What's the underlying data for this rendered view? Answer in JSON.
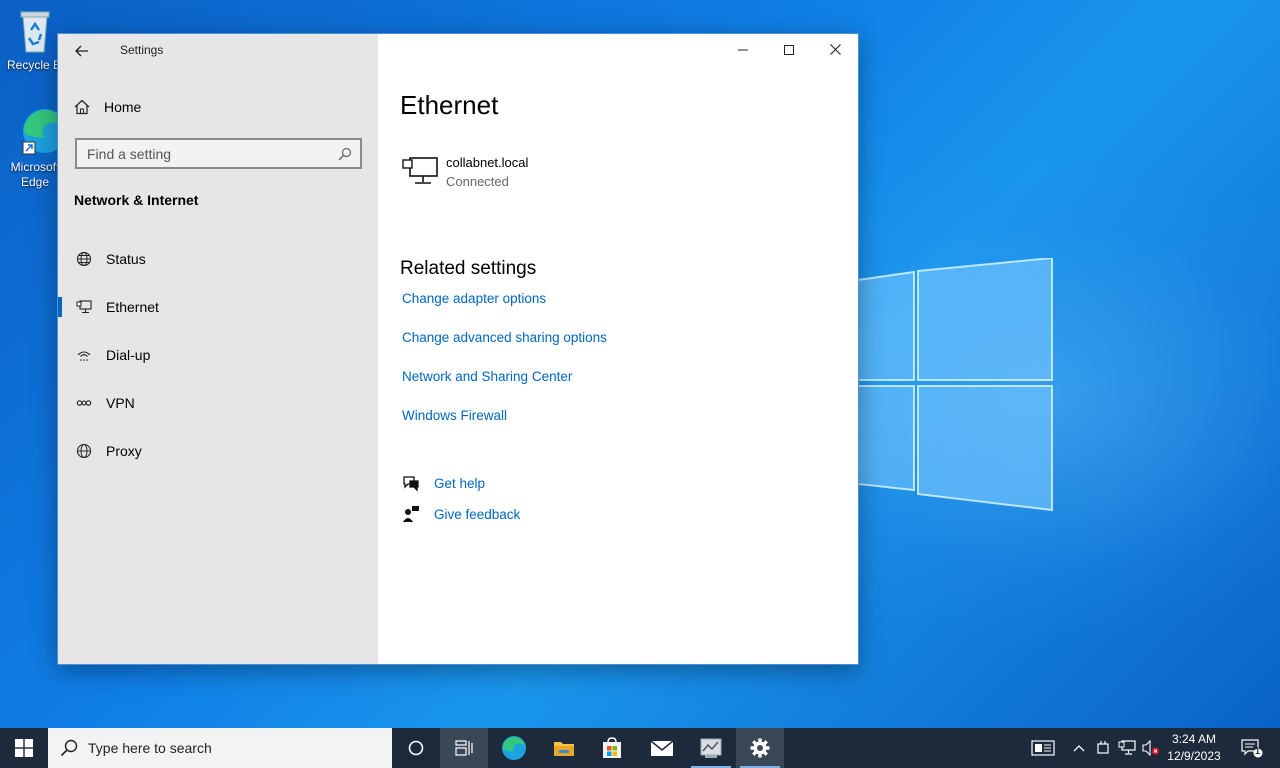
{
  "desktop": {
    "icons": [
      {
        "label": "Recycle Bin",
        "icon": "recycle-bin-icon"
      },
      {
        "label": "Microsoft Edge",
        "icon": "edge-icon"
      }
    ]
  },
  "window": {
    "app_title": "Settings",
    "nav": {
      "home_label": "Home",
      "search_placeholder": "Find a setting",
      "section_title": "Network & Internet",
      "items": [
        {
          "label": "Status",
          "icon": "globe-status-icon",
          "active": false
        },
        {
          "label": "Ethernet",
          "icon": "ethernet-icon",
          "active": true
        },
        {
          "label": "Dial-up",
          "icon": "dialup-icon",
          "active": false
        },
        {
          "label": "VPN",
          "icon": "vpn-icon",
          "active": false
        },
        {
          "label": "Proxy",
          "icon": "globe-icon",
          "active": false
        }
      ]
    },
    "content": {
      "title": "Ethernet",
      "network": {
        "name": "collabnet.local",
        "status": "Connected"
      },
      "related_title": "Related settings",
      "links": [
        "Change adapter options",
        "Change advanced sharing options",
        "Network and Sharing Center",
        "Windows Firewall"
      ],
      "help": {
        "get_help": "Get help",
        "give_feedback": "Give feedback"
      }
    }
  },
  "taskbar": {
    "search_placeholder": "Type here to search",
    "apps": [
      "cortana-icon",
      "task-view-icon",
      "edge-icon",
      "file-explorer-icon",
      "store-icon",
      "mail-icon",
      "server-manager-icon",
      "settings-icon"
    ],
    "time": "3:24 AM",
    "date": "12/9/2023",
    "notification_count": "1"
  },
  "colors": {
    "accent": "#0067c0",
    "taskbar": "#1c2a3c",
    "nav_bg": "#e6e6e6"
  }
}
